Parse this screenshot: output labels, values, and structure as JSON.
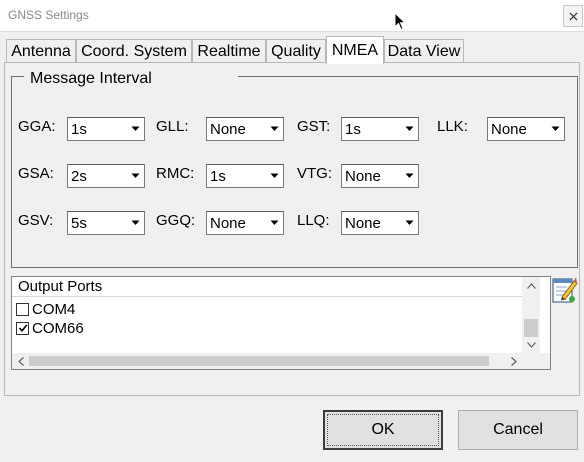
{
  "window": {
    "title": "GNSS Settings",
    "close_icon": "close-icon"
  },
  "tabs": [
    {
      "label": "Antenna",
      "active": false
    },
    {
      "label": "Coord. System",
      "active": false
    },
    {
      "label": "Realtime",
      "active": false
    },
    {
      "label": "Quality",
      "active": false
    },
    {
      "label": "NMEA",
      "active": true
    },
    {
      "label": "Data View",
      "active": false
    }
  ],
  "message_interval": {
    "title": "Message Interval",
    "fields": {
      "gga": {
        "label": "GGA:",
        "value": "1s"
      },
      "gll": {
        "label": "GLL:",
        "value": "None"
      },
      "gst": {
        "label": "GST:",
        "value": "1s"
      },
      "llk": {
        "label": "LLK:",
        "value": "None"
      },
      "gsa": {
        "label": "GSA:",
        "value": "2s"
      },
      "rmc": {
        "label": "RMC:",
        "value": "1s"
      },
      "vtg": {
        "label": "VTG:",
        "value": "None"
      },
      "gsv": {
        "label": "GSV:",
        "value": "5s"
      },
      "ggq": {
        "label": "GGQ:",
        "value": "None"
      },
      "llq": {
        "label": "LLQ:",
        "value": "None"
      }
    }
  },
  "output_ports": {
    "header": "Output Ports",
    "items": [
      {
        "label": "COM4",
        "checked": false
      },
      {
        "label": "COM66",
        "checked": true
      }
    ]
  },
  "buttons": {
    "ok": "OK",
    "cancel": "Cancel"
  },
  "colors": {
    "window_bg": "#f0f0f0",
    "tab_active_bg": "#ffffff",
    "button_bg": "#e1e1e1"
  }
}
